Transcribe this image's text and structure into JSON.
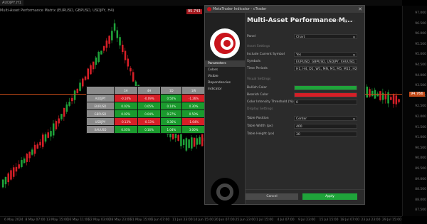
{
  "chart": {
    "tab_label": "AUDJPY,H1",
    "symbol_line": "Multi-Asset Performance Matrix (EURUSD, GBPUSD, USDJPY, H4)",
    "current_price_tag": "95.743",
    "price_line_label": "94.766",
    "top_tag": "95.743",
    "price_axis": [
      "97.000",
      "96.500",
      "96.000",
      "95.500",
      "95.000",
      "94.500",
      "94.000",
      "93.500",
      "93.000",
      "92.500",
      "92.000",
      "91.500",
      "91.000",
      "90.500",
      "90.000",
      "89.500",
      "89.000",
      "88.500",
      "88.000",
      "87.500"
    ],
    "time_axis": [
      "6 May 2024",
      "8 May 07:00",
      "13 May 15:00",
      "16 May 11:00",
      "22 May 03:00",
      "28 May 23:00",
      "31 May 15:00",
      "6 Jun 07:00",
      "11 Jun 23:00",
      "14 Jun 15:00",
      "20 Jun 07:00",
      "25 Jun 23:00",
      "1 Jul 15:00",
      "4 Jul 07:00",
      "9 Jul 23:00",
      "15 Jul 15:00",
      "18 Jul 07:00",
      "23 Jul 23:00",
      "29 Jul 15:00"
    ],
    "colors": {
      "bull": "#1fa43a",
      "bear": "#d61f27",
      "line": "#c24a18"
    }
  },
  "table": {
    "headers": [
      "",
      "1H",
      "4H",
      "1D",
      "1W"
    ],
    "rows": [
      {
        "symbol": "AUDJPY",
        "cells": [
          {
            "v": "-0.10%",
            "c": "neg"
          },
          {
            "v": "-0.09%",
            "c": "neg"
          },
          {
            "v": "0.50%",
            "c": "pos"
          },
          {
            "v": "-1.26%",
            "c": "neg"
          }
        ]
      },
      {
        "symbol": "EURUSD",
        "cells": [
          {
            "v": "0.02%",
            "c": "pos"
          },
          {
            "v": "0.05%",
            "c": "pos"
          },
          {
            "v": "0.14%",
            "c": "pos"
          },
          {
            "v": "0.30%",
            "c": "pos"
          }
        ]
      },
      {
        "symbol": "GBPUSD",
        "cells": [
          {
            "v": "0.02%",
            "c": "pos"
          },
          {
            "v": "0.04%",
            "c": "pos"
          },
          {
            "v": "0.27%",
            "c": "pos"
          },
          {
            "v": "0.50%",
            "c": "pos"
          }
        ]
      },
      {
        "symbol": "USDJPY",
        "cells": [
          {
            "v": "-0.13%",
            "c": "neg"
          },
          {
            "v": "-0.13%",
            "c": "neg"
          },
          {
            "v": "0.36%",
            "c": "pos"
          },
          {
            "v": "-1.64%",
            "c": "neg"
          }
        ]
      },
      {
        "symbol": "XAUUSD",
        "cells": [
          {
            "v": "0.01%",
            "c": "pos"
          },
          {
            "v": "0.16%",
            "c": "pos"
          },
          {
            "v": "1.04%",
            "c": "pos"
          },
          {
            "v": "3.00%",
            "c": "pos"
          }
        ]
      }
    ]
  },
  "dialog": {
    "window_title": "MetaTrader Indicator - cTrader",
    "close": "✕",
    "header": "Multi-Asset Performance M...",
    "nav": [
      "Parameters",
      "Colors",
      "Visible",
      "Dependencies Indicator"
    ],
    "sections": {
      "general": "General",
      "assets": "Asset Settings",
      "colors": "Visual Settings",
      "display": "Display Settings"
    },
    "fields": {
      "panel_label": "Panel",
      "panel_value": "Chart",
      "include_label": "Include Current Symbol",
      "include_value": "Yes",
      "symbols_label": "Symbols",
      "symbols_value": "EURUSD, GBPUSD, USDJPY, XAUUSD, EUR",
      "timeframes_label": "Time Periods",
      "timeframes_value": "H1, H4, D1, W1, MN, M1, M5, M15, H2, D1",
      "bullish_label": "Bullish Color",
      "bearish_label": "Bearish Color",
      "decimals_label": "Color Intensity Threshold (%)",
      "decimals_value": "0",
      "position_label": "Table Position",
      "position_value": "Center",
      "width_label": "Table Width (px)",
      "width_value": "400",
      "height_label": "Table Height (px)",
      "height_value": "30"
    },
    "buttons": {
      "cancel": "Cancel",
      "apply": "Apply"
    }
  }
}
